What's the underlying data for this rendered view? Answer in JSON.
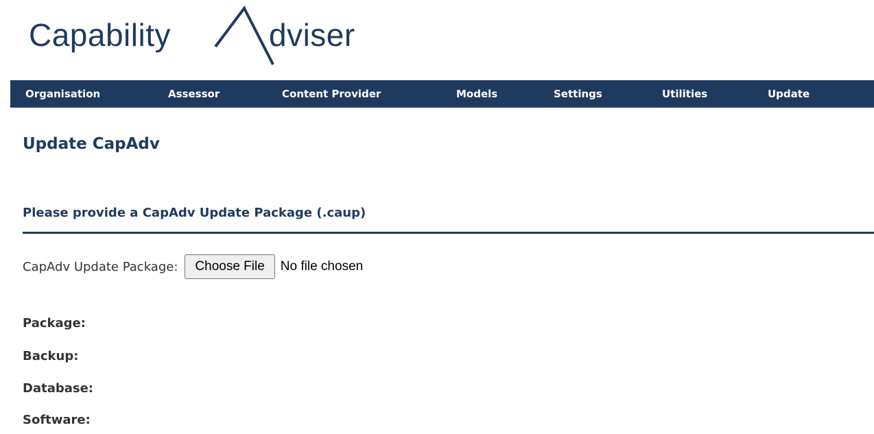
{
  "logo": {
    "text_part1": "Capability",
    "text_part2": "dviser"
  },
  "nav": {
    "items": [
      {
        "label": "Organisation"
      },
      {
        "label": "Assessor"
      },
      {
        "label": "Content Provider"
      },
      {
        "label": "Models"
      },
      {
        "label": "Settings"
      },
      {
        "label": "Utilities"
      },
      {
        "label": "Update"
      }
    ]
  },
  "page": {
    "title": "Update CapAdv",
    "section_title": "Please provide a CapAdv Update Package (.caup)"
  },
  "upload": {
    "label": "CapAdv Update Package:",
    "button_label": "Choose File",
    "status": "No file chosen"
  },
  "status": {
    "package_label": "Package:",
    "backup_label": "Backup:",
    "database_label": "Database:",
    "software_label": "Software:"
  },
  "colors": {
    "brand": "#1f3a5f",
    "nav_text": "#ffffff"
  }
}
